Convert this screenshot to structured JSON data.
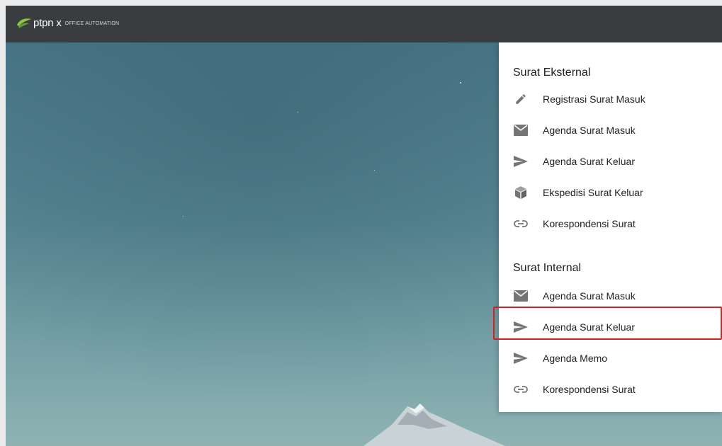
{
  "header": {
    "brand_name": "ptpn x",
    "brand_tagline": "OFFICE AUTOMATION",
    "brand_icon": "leaf-logo-icon",
    "background_color": "#3a3d3f"
  },
  "menu": {
    "sections": [
      {
        "title": "Surat Eksternal",
        "items": [
          {
            "label": "Registrasi Surat Masuk",
            "icon": "pencil-icon"
          },
          {
            "label": "Agenda Surat Masuk",
            "icon": "mail-icon"
          },
          {
            "label": "Agenda Surat Keluar",
            "icon": "send-icon"
          },
          {
            "label": "Ekspedisi Surat Keluar",
            "icon": "package-icon"
          },
          {
            "label": "Korespondensi Surat",
            "icon": "link-icon"
          }
        ]
      },
      {
        "title": "Surat Internal",
        "items": [
          {
            "label": "Agenda Surat Masuk",
            "icon": "mail-icon"
          },
          {
            "label": "Agenda Surat Keluar",
            "icon": "send-icon",
            "highlighted": true
          },
          {
            "label": "Agenda Memo",
            "icon": "send-icon"
          },
          {
            "label": "Korespondensi Surat",
            "icon": "link-icon"
          }
        ]
      }
    ]
  },
  "colors": {
    "icon": "#757575",
    "highlight_border": "#d32020",
    "logo_green": "#8dc63f"
  }
}
